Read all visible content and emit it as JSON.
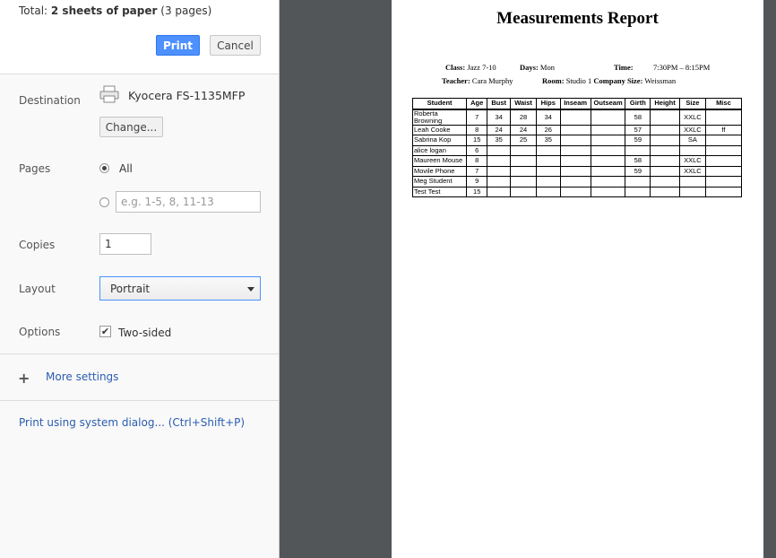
{
  "summary": {
    "prefix": "Total:",
    "bold": "2 sheets of paper",
    "suffix": "(3 pages)"
  },
  "buttons": {
    "print": "Print",
    "cancel": "Cancel",
    "change": "Change..."
  },
  "destination": {
    "label": "Destination",
    "printer": "Kyocera FS-1135MFP"
  },
  "pages": {
    "label": "Pages",
    "all": "All",
    "custom_placeholder": "e.g. 1-5, 8, 11-13",
    "selected": "All"
  },
  "copies": {
    "label": "Copies",
    "value": "1"
  },
  "layout": {
    "label": "Layout",
    "value": "Portrait"
  },
  "options": {
    "label": "Options",
    "two_sided": "Two-sided",
    "two_sided_checked": true
  },
  "more_settings": "More settings",
  "system_dialog": "Print using system dialog... (Ctrl+Shift+P)",
  "colors": {
    "accent": "#4d90fe",
    "link": "#2a5db0",
    "preview_bg": "#525659"
  },
  "report": {
    "title": "Measurements Report",
    "class_label": "Class:",
    "class_value": "Jazz 7-10",
    "days_label": "Days:",
    "days_value": "Mon",
    "time_label": "Time:",
    "time_value": "7:30PM – 8:15PM",
    "teacher_label": "Teacher:",
    "teacher_value": "Cara Murphy",
    "room_label": "Room:",
    "room_value": "Studio 1",
    "size_label": "Company Size:",
    "size_value": "Weissman",
    "columns": [
      "Student",
      "Age",
      "Bust",
      "Waist",
      "Hips",
      "Inseam",
      "Outseam",
      "Girth",
      "Height",
      "Size",
      "Misc"
    ],
    "rows": [
      [
        "Roberta Browning",
        "7",
        "34",
        "28",
        "34",
        "",
        "",
        "58",
        "",
        "XXLC",
        ""
      ],
      [
        "Leah Cooke",
        "8",
        "24",
        "24",
        "26",
        "",
        "",
        "57",
        "",
        "XXLC",
        "ff"
      ],
      [
        "Sabrina Kop",
        "15",
        "35",
        "25",
        "35",
        "",
        "",
        "59",
        "",
        "SA",
        ""
      ],
      [
        "alice logan",
        "6",
        "",
        "",
        "",
        "",
        "",
        "",
        "",
        "",
        ""
      ],
      [
        "Maureen Mouse",
        "8",
        "",
        "",
        "",
        "",
        "",
        "58",
        "",
        "XXLC",
        ""
      ],
      [
        "Movile Phone",
        "7",
        "",
        "",
        "",
        "",
        "",
        "59",
        "",
        "XXLC",
        ""
      ],
      [
        "Meg Student",
        "9",
        "",
        "",
        "",
        "",
        "",
        "",
        "",
        "",
        ""
      ],
      [
        "Test Test",
        "15",
        "",
        "",
        "",
        "",
        "",
        "",
        "",
        "",
        ""
      ]
    ]
  }
}
